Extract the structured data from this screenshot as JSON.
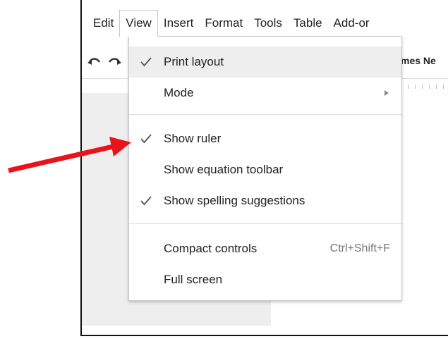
{
  "menubar": {
    "items": [
      {
        "label": "Edit"
      },
      {
        "label": "View"
      },
      {
        "label": "Insert"
      },
      {
        "label": "Format"
      },
      {
        "label": "Tools"
      },
      {
        "label": "Table"
      },
      {
        "label": "Add-or"
      }
    ]
  },
  "toolbar": {
    "undo_icon": "undo-icon",
    "redo_icon": "redo-icon",
    "font_partial": "mes Ne"
  },
  "view_menu": {
    "items": [
      {
        "label": "Print layout",
        "checked": true
      },
      {
        "label": "Mode",
        "submenu": true
      },
      {
        "label": "Show ruler",
        "checked": true
      },
      {
        "label": "Show equation toolbar",
        "checked": false
      },
      {
        "label": "Show spelling suggestions",
        "checked": true
      },
      {
        "label": "Compact controls",
        "shortcut": "Ctrl+Shift+F"
      },
      {
        "label": "Full screen"
      }
    ]
  },
  "colors": {
    "arrow": "#e8141b",
    "menu_hover": "#eeeeee",
    "check": "#555555"
  }
}
